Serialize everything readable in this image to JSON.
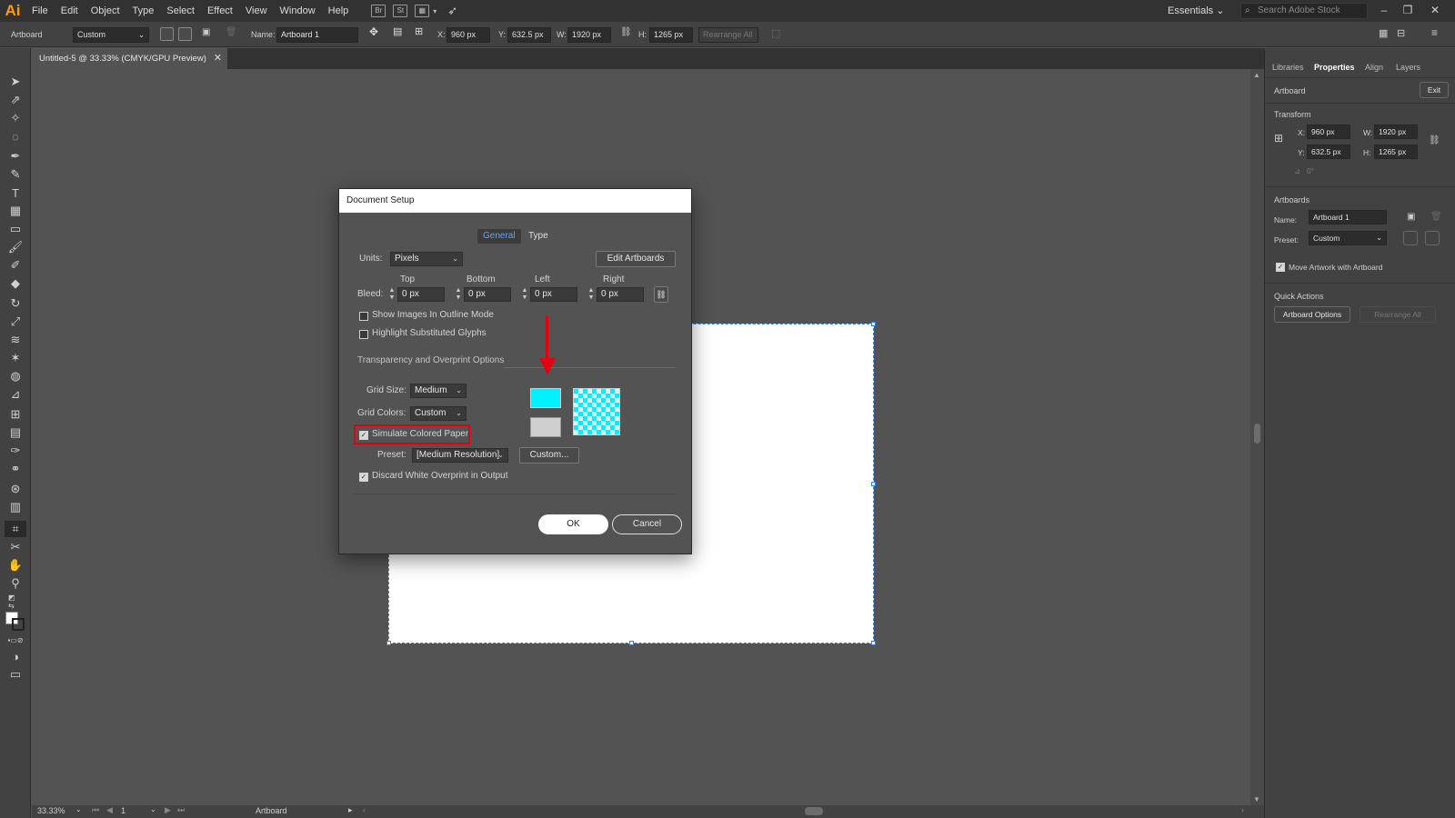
{
  "app": {
    "logo": "Ai"
  },
  "menubar": {
    "items": [
      "File",
      "Edit",
      "Object",
      "Type",
      "Select",
      "Effect",
      "View",
      "Window",
      "Help"
    ],
    "workspace": "Essentials ⌄",
    "search_placeholder": "Search Adobe Stock"
  },
  "controlbar": {
    "mode_label": "Artboard",
    "preset_value": "Custom",
    "name_label": "Name:",
    "name_value": "Artboard 1",
    "x_label": "X:",
    "x_value": "960 px",
    "y_label": "Y:",
    "y_value": "632.5 px",
    "w_label": "W:",
    "w_value": "1920 px",
    "h_label": "H:",
    "h_value": "1265 px",
    "rearrange_label": "Rearrange All"
  },
  "document": {
    "tab_title": "Untitled-5 @ 33.33% (CMYK/GPU Preview)",
    "zoom": "33.33%",
    "page": "1",
    "status_tool": "Artboard"
  },
  "dialog": {
    "title": "Document Setup",
    "tabs": [
      "General",
      "Type"
    ],
    "active_tab": "General",
    "units_label": "Units:",
    "units_value": "Pixels",
    "edit_artboards": "Edit Artboards",
    "bleed_label": "Bleed:",
    "bleed": [
      {
        "label": "Top",
        "value": "0 px"
      },
      {
        "label": "Bottom",
        "value": "0 px"
      },
      {
        "label": "Left",
        "value": "0 px"
      },
      {
        "label": "Right",
        "value": "0 px"
      }
    ],
    "show_images_outline": {
      "label": "Show Images In Outline Mode",
      "checked": false
    },
    "highlight_glyphs": {
      "label": "Highlight Substituted Glyphs",
      "checked": false
    },
    "transparency_section": "Transparency and Overprint Options",
    "grid_size_label": "Grid Size:",
    "grid_size_value": "Medium",
    "grid_colors_label": "Grid Colors:",
    "grid_colors_value": "Custom",
    "simulate_paper": {
      "label": "Simulate Colored Paper",
      "checked": true
    },
    "preset_label": "Preset:",
    "preset_value": "[Medium Resolution]",
    "custom_button": "Custom...",
    "discard_overprint": {
      "label": "Discard White Overprint in Output",
      "checked": true
    },
    "ok": "OK",
    "cancel": "Cancel",
    "swatch_top_color": "#00f0ff",
    "swatch_bottom_color": "#cfcfcf"
  },
  "rightpanel": {
    "tabs": [
      "Libraries",
      "Properties",
      "Align",
      "Layers"
    ],
    "active_tab": "Properties",
    "artboard_label": "Artboard",
    "exit_button": "Exit",
    "transform_label": "Transform",
    "x_label": "X:",
    "x_value": "960 px",
    "y_label": "Y:",
    "y_value": "632.5 px",
    "w_label": "W:",
    "w_value": "1920 px",
    "h_label": "H:",
    "h_value": "1265 px",
    "angle_value": "0°",
    "artboards_section": "Artboards",
    "name_label": "Name:",
    "name_value": "Artboard 1",
    "preset_label": "Preset:",
    "preset_value": "Custom",
    "move_artwork": "Move Artwork with Artboard",
    "quick_actions": "Quick Actions",
    "artboard_options": "Artboard Options",
    "rearrange_all": "Rearrange All"
  },
  "colors": {
    "highlight": "#e4000f",
    "selection": "#2d7ff7",
    "accent_tab": "#5aa3ff"
  }
}
